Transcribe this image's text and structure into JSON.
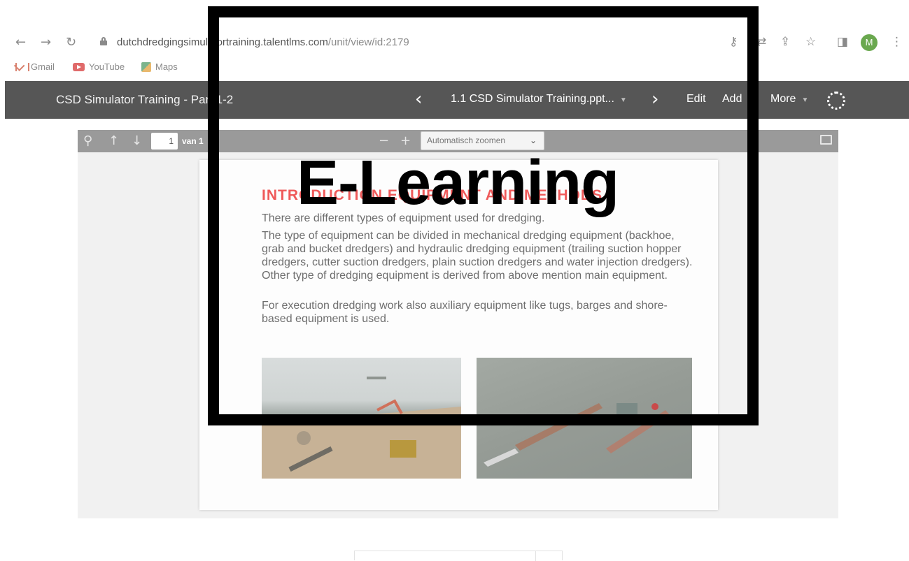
{
  "browser": {
    "url_host": "dutchdredgingsimulatortraining.talentlms.com",
    "url_path": "/unit/view/id:2179",
    "avatar_letter": "M",
    "icons": [
      "back-arrow-icon",
      "forward-arrow-icon",
      "reload-icon",
      "lock-icon",
      "key-icon",
      "translate-icon",
      "share-icon",
      "star-icon",
      "sidebar-icon",
      "more-vertical-icon"
    ],
    "bookmarks": [
      {
        "label": "Gmail",
        "icon": "gmail-icon"
      },
      {
        "label": "YouTube",
        "icon": "youtube-icon"
      },
      {
        "label": "Maps",
        "icon": "maps-icon"
      }
    ]
  },
  "appbar": {
    "course_title": "CSD Simulator Training - Part 1-2",
    "unit_title": "1.1 CSD Simulator Training.ppt...",
    "edit_label": "Edit",
    "add_label": "Add",
    "more_label": "More",
    "background_color": "#565656"
  },
  "pdf_viewer": {
    "current_page": "1",
    "page_count_label": "van 1",
    "zoom_label": "Automatisch zoomen"
  },
  "slide": {
    "heading": "INTRODUCTION EQUIPMENT AND METHODS",
    "heading_color": "#ef5a5a",
    "paragraph_1": "There are different types of equipment used for dredging.",
    "paragraph_2": "The type of equipment can be divided in mechanical dredging equipment (backhoe, grab and bucket dredgers) and hydraulic dredging equipment (trailing suction hopper dredgers, cutter suction dredgers, plain suction dredgers and water injection dredgers). Other type of dredging equipment is derived from above mention main equipment.",
    "paragraph_3": "For execution dredging work also auxiliary equipment like tugs, barges and shore-based equipment is used."
  },
  "overlay": {
    "title": "E-Learning"
  }
}
